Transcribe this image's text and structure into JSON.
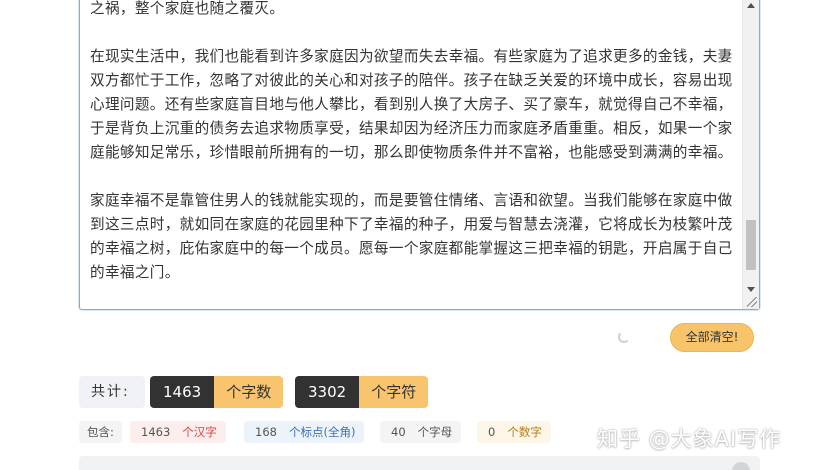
{
  "editor": {
    "paragraphs": [
      "之祸，整个家庭也随之覆灭。",
      "在现实生活中，我们也能看到许多家庭因为欲望而失去幸福。有些家庭为了追求更多的金钱，夫妻双方都忙于工作，忽略了对彼此的关心和对孩子的陪伴。孩子在缺乏关爱的环境中成长，容易出现心理问题。还有些家庭盲目地与他人攀比，看到别人换了大房子、买了豪车，就觉得自己不幸福，于是背负上沉重的债务去追求物质享受，结果却因为经济压力而家庭矛盾重重。相反，如果一个家庭能够知足常乐，珍惜眼前所拥有的一切，那么即使物质条件并不富裕，也能感受到满满的幸福。",
      "家庭幸福不是靠管住男人的钱就能实现的，而是要管住情绪、言语和欲望。当我们能够在家庭中做到这三点时，就如同在家庭的花园里种下了幸福的种子，用爱与智慧去浇灌，它将成长为枝繁叶茂的幸福之树，庇佑家庭中的每一个成员。愿每一个家庭都能掌握这三把幸福的钥匙，开启属于自己的幸福之门。"
    ]
  },
  "actions": {
    "clear_label": "全部清空!"
  },
  "totals": {
    "label": "共计:",
    "char_count": "1463",
    "char_unit": "个字数",
    "byte_count": "3302",
    "byte_unit": "个字符"
  },
  "breakdown": {
    "label": "包含:",
    "hanzi_count": "1463",
    "hanzi_label": "个汉字",
    "punct_count": "168",
    "punct_label": "个标点(全角)",
    "letter_count": "40",
    "letter_label": "个字母",
    "digit_count": "0",
    "digit_label": "个数字"
  },
  "watermark": "知乎 @大象AI写作"
}
